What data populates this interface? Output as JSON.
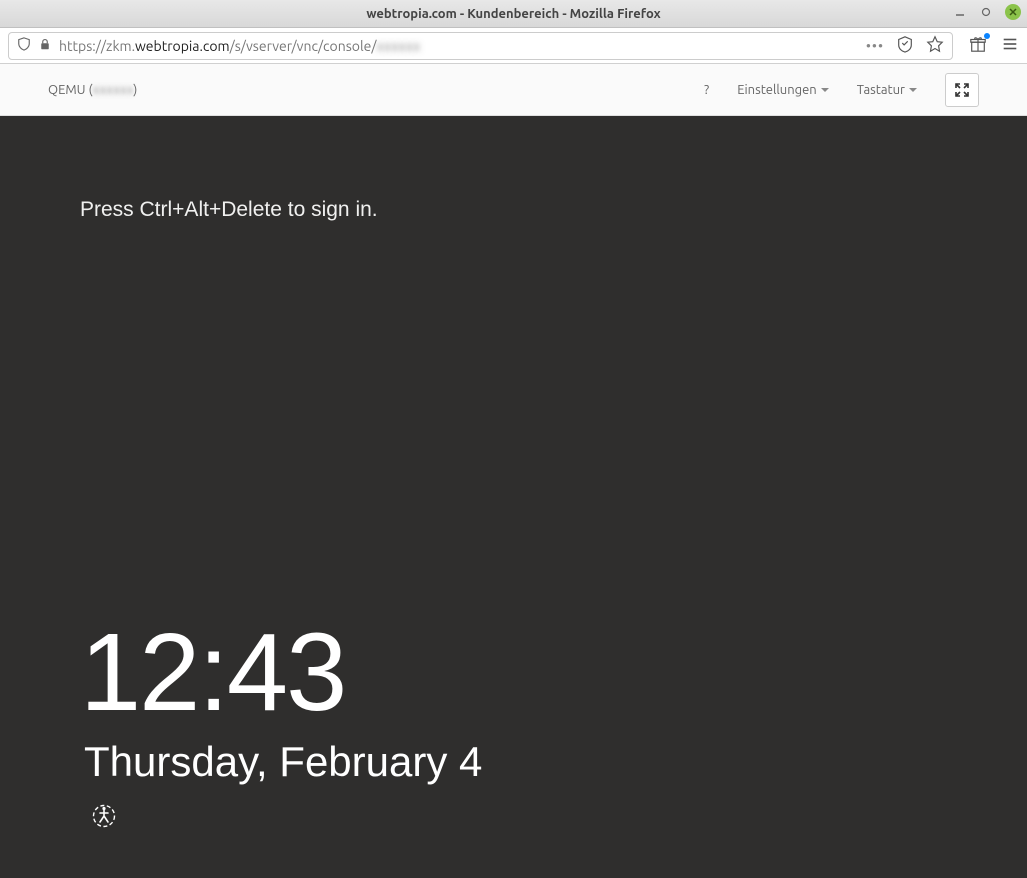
{
  "window": {
    "title": "webtropia.com - Kundenbereich - Mozilla Firefox"
  },
  "urlbar": {
    "prefix": "https://zkm.",
    "domain": "webtropia.com",
    "path": "/s/vserver/vnc/console/",
    "obscured": "xxxxxx"
  },
  "novnc": {
    "title_prefix": "QEMU (",
    "title_obscured": "xxxxxx",
    "title_suffix": ")",
    "help": "?",
    "settings": "Einstellungen",
    "keyboard": "Tastatur"
  },
  "lockscreen": {
    "hint": "Press Ctrl+Alt+Delete to sign in.",
    "time": "12:43",
    "date": "Thursday, February 4"
  }
}
